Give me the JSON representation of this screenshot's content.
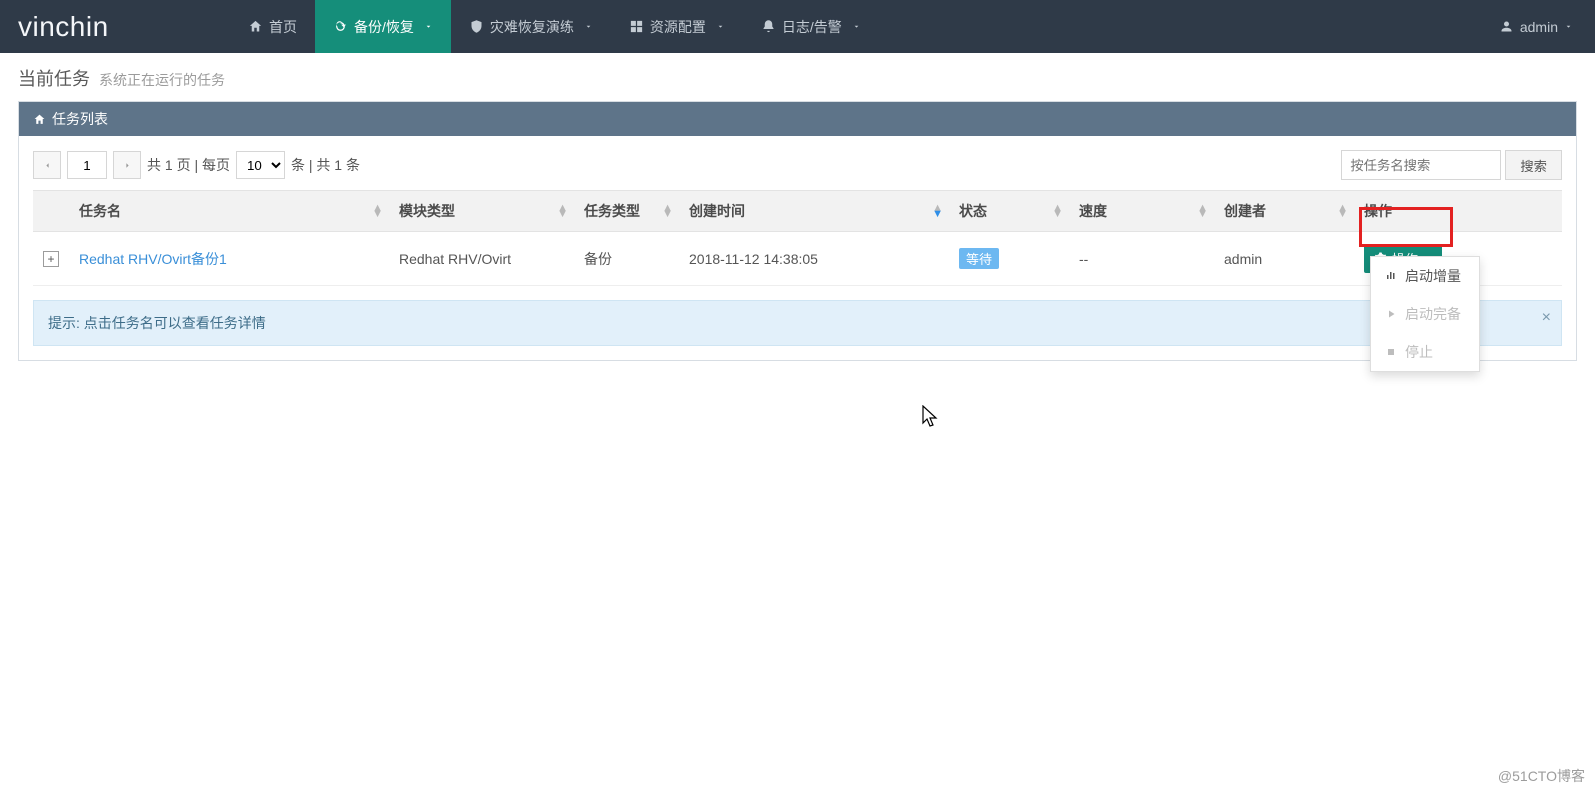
{
  "brand": "vinchin",
  "nav": {
    "home": "首页",
    "backup": "备份/恢复",
    "dr": "灾难恢复演练",
    "resource": "资源配置",
    "log": "日志/告警"
  },
  "user": {
    "name": "admin"
  },
  "page": {
    "title": "当前任务",
    "subtitle": "系统正在运行的任务"
  },
  "panel": {
    "title": "任务列表"
  },
  "pager": {
    "page": "1",
    "pages_prefix": "共 1 页 | 每页",
    "per_page": "10",
    "suffix": "条 | 共 1 条"
  },
  "search": {
    "placeholder": "按任务名搜索",
    "button": "搜索"
  },
  "columns": {
    "name": "任务名",
    "module": "模块类型",
    "type": "任务类型",
    "created": "创建时间",
    "status": "状态",
    "speed": "速度",
    "creator": "创建者",
    "op": "操作"
  },
  "rows": [
    {
      "name": "Redhat RHV/Ovirt备份1",
      "module": "Redhat RHV/Ovirt",
      "type": "备份",
      "created": "2018-11-12 14:38:05",
      "status": "等待",
      "speed": "--",
      "creator": "admin",
      "op_label": "操作"
    }
  ],
  "dropdown": {
    "start_incremental": "启动增量",
    "start_full": "启动完备",
    "stop": "停止"
  },
  "alert": {
    "text": "提示: 点击任务名可以查看任务详情"
  },
  "watermark": "@51CTO博客"
}
